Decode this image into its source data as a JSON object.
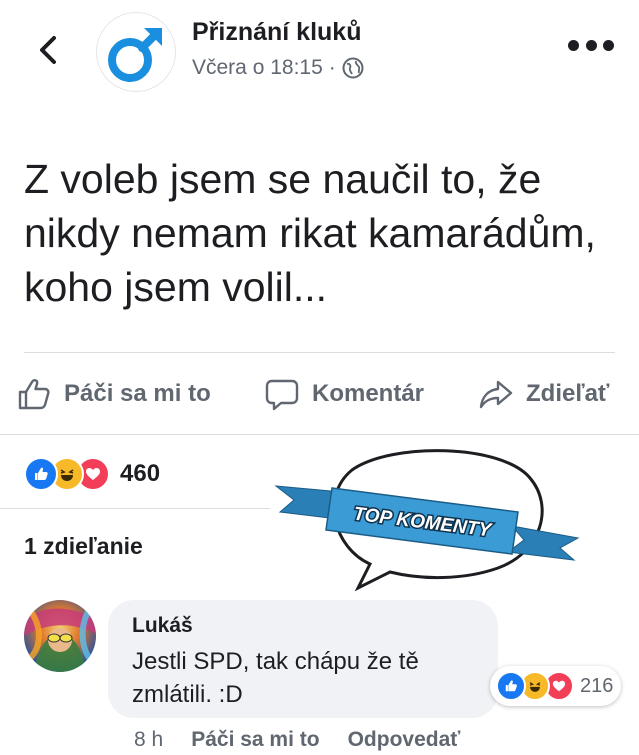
{
  "header": {
    "page_name": "Přiznání kluků",
    "timestamp": "Včera o 18:15",
    "separator": "·",
    "privacy_icon": "globe-icon",
    "back_icon": "chevron-left-icon",
    "more_icon": "more-dots-icon"
  },
  "post": {
    "text": "Z voleb jsem se naučil to, že nikdy nemam rikat kamarádům, koho jsem volil..."
  },
  "actions": {
    "like_label": "Páči sa mi to",
    "comment_label": "Komentár",
    "share_label": "Zdieľať"
  },
  "reactions": {
    "icons": [
      "like-icon",
      "haha-icon",
      "love-icon"
    ],
    "count": "460"
  },
  "shares": {
    "label": "1 zdieľanie"
  },
  "badge": {
    "text": "TOP KOMENTY"
  },
  "comment": {
    "author": "Lukáš",
    "text": "Jestli SPD, tak chápu že tě zmlátili. :D",
    "reaction_count": "216",
    "time": "8 h",
    "like_label": "Páči sa mi to",
    "reply_label": "Odpovedať"
  },
  "colors": {
    "like_blue": "#1877f2",
    "haha_yellow": "#f7b928",
    "love_red": "#f33e58",
    "badge_blue": "#2f8fc9",
    "brand_logo_blue": "#1a8fe0"
  }
}
